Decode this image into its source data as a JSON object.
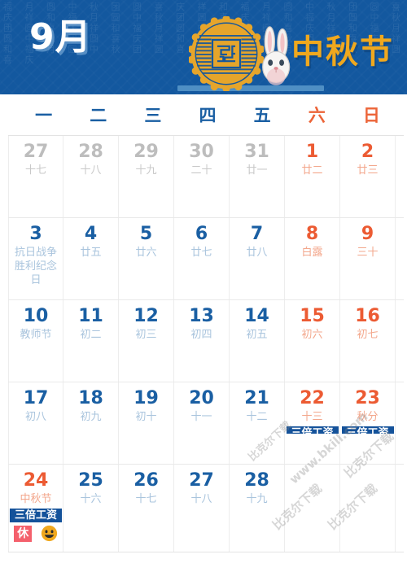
{
  "banner": {
    "month_label": "9月",
    "festival_title": "中秋节",
    "mooncake_icon": "mooncake-icon",
    "rabbit_icon": "rabbit-icon",
    "bg_color": "#13589f",
    "accent_color": "#f0a81e",
    "pattern_glyphs": "福 月 圆 中 秋 团 圆 喜 庆 祥 和 福 月 圆 中 秋 团 圆 喜 庆 祥 和 福 月 圆 中 秋 团 圆 喜 庆 祥 和 福 月 圆 中 秋 团 圆 喜 庆 祥 和 福 月 圆 中 秋 团 圆 喜 庆 祥 和 福 月 圆 中 秋 团 圆 喜 庆 祥 和 福 月 圆 中 秋 团 圆 喜 庆 祥 和 福 月 圆 中 秋 团 圆 喜 庆 祥 和 福 月 圆 中 秋 团 圆 喜 庆"
  },
  "weekdays": [
    {
      "label": "一",
      "weekend": false
    },
    {
      "label": "二",
      "weekend": false
    },
    {
      "label": "三",
      "weekend": false
    },
    {
      "label": "四",
      "weekend": false
    },
    {
      "label": "五",
      "weekend": false
    },
    {
      "label": "六",
      "weekend": true
    },
    {
      "label": "日",
      "weekend": true
    }
  ],
  "colors": {
    "weekday_blue": "#1a5fa3",
    "weekend_orange": "#ec5b33",
    "lunar_blue": "#a9c4dd",
    "other_month_gray": "#bdbdbd",
    "wage_badge_bg": "#14529a",
    "rest_badge_bg": "#f4606c"
  },
  "weeks": [
    [
      {
        "num": "27",
        "sub": "十七",
        "other": true,
        "weekend": false
      },
      {
        "num": "28",
        "sub": "十八",
        "other": true,
        "weekend": false
      },
      {
        "num": "29",
        "sub": "十九",
        "other": true,
        "weekend": false
      },
      {
        "num": "30",
        "sub": "二十",
        "other": true,
        "weekend": false
      },
      {
        "num": "31",
        "sub": "廿一",
        "other": true,
        "weekend": false
      },
      {
        "num": "1",
        "sub": "廿二",
        "other": false,
        "weekend": true
      },
      {
        "num": "2",
        "sub": "廿三",
        "other": false,
        "weekend": true
      }
    ],
    [
      {
        "num": "3",
        "sub": "抗日战争胜利纪念日",
        "other": false,
        "weekend": false
      },
      {
        "num": "4",
        "sub": "廿五",
        "other": false,
        "weekend": false
      },
      {
        "num": "5",
        "sub": "廿六",
        "other": false,
        "weekend": false
      },
      {
        "num": "6",
        "sub": "廿七",
        "other": false,
        "weekend": false
      },
      {
        "num": "7",
        "sub": "廿八",
        "other": false,
        "weekend": false
      },
      {
        "num": "8",
        "sub": "白露",
        "other": false,
        "weekend": true
      },
      {
        "num": "9",
        "sub": "三十",
        "other": false,
        "weekend": true
      }
    ],
    [
      {
        "num": "10",
        "sub": "教师节",
        "other": false,
        "weekend": false
      },
      {
        "num": "11",
        "sub": "初二",
        "other": false,
        "weekend": false
      },
      {
        "num": "12",
        "sub": "初三",
        "other": false,
        "weekend": false
      },
      {
        "num": "13",
        "sub": "初四",
        "other": false,
        "weekend": false
      },
      {
        "num": "14",
        "sub": "初五",
        "other": false,
        "weekend": false
      },
      {
        "num": "15",
        "sub": "初六",
        "other": false,
        "weekend": true
      },
      {
        "num": "16",
        "sub": "初七",
        "other": false,
        "weekend": true
      }
    ],
    [
      {
        "num": "17",
        "sub": "初八",
        "other": false,
        "weekend": false
      },
      {
        "num": "18",
        "sub": "初九",
        "other": false,
        "weekend": false
      },
      {
        "num": "19",
        "sub": "初十",
        "other": false,
        "weekend": false
      },
      {
        "num": "20",
        "sub": "十一",
        "other": false,
        "weekend": false
      },
      {
        "num": "21",
        "sub": "十二",
        "other": false,
        "weekend": false
      },
      {
        "num": "22",
        "sub": "十三",
        "other": false,
        "weekend": true,
        "wage_badge": "三倍工资",
        "wage_clipped": true
      },
      {
        "num": "23",
        "sub": "秋分",
        "other": false,
        "weekend": true,
        "wage_badge": "三倍工资",
        "wage_clipped": true
      }
    ],
    [
      {
        "num": "24",
        "sub": "中秋节",
        "other": false,
        "weekend": true,
        "wage_badge": "三倍工资",
        "rest_badge": "休",
        "emoji": "smile-emoji"
      },
      {
        "num": "25",
        "sub": "十六",
        "other": false,
        "weekend": false
      },
      {
        "num": "26",
        "sub": "十七",
        "other": false,
        "weekend": false
      },
      {
        "num": "27",
        "sub": "十八",
        "other": false,
        "weekend": false
      },
      {
        "num": "28",
        "sub": "十九",
        "other": false,
        "weekend": false
      },
      {
        "num": "",
        "sub": "",
        "other": false,
        "weekend": false,
        "empty": true
      },
      {
        "num": "",
        "sub": "",
        "other": false,
        "weekend": false,
        "empty": true
      }
    ]
  ],
  "watermarks": [
    "比克尔下载",
    "www.bkill.com",
    "比克尔下载",
    "比克尔下载",
    "比克尔下载"
  ]
}
